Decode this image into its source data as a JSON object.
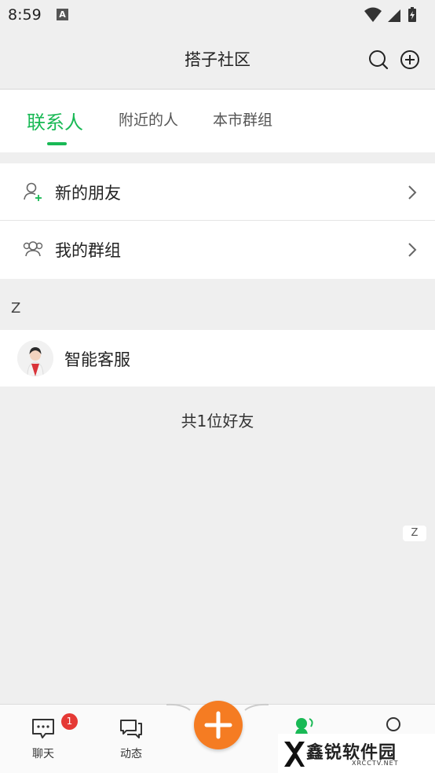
{
  "status_bar": {
    "time": "8:59",
    "notification_letter": "A"
  },
  "header": {
    "title": "搭子社区"
  },
  "tabs": [
    {
      "label": "联系人",
      "active": true
    },
    {
      "label": "附近的人",
      "active": false
    },
    {
      "label": "本市群组",
      "active": false
    }
  ],
  "menu": {
    "new_friends": "新的朋友",
    "my_groups": "我的群组"
  },
  "section_letter": "Z",
  "contacts": [
    {
      "name": "智能客服"
    }
  ],
  "friend_count": "共1位好友",
  "index_letter": "Z",
  "bottom_nav": {
    "chat_label": "聊天",
    "chat_badge": "1",
    "moments_label": "动态"
  },
  "watermark": {
    "title": "鑫锐软件园",
    "subtitle": "XRCCTV.NET"
  },
  "colors": {
    "accent": "#19b955",
    "fab": "#f57c22",
    "badge": "#e53935"
  }
}
